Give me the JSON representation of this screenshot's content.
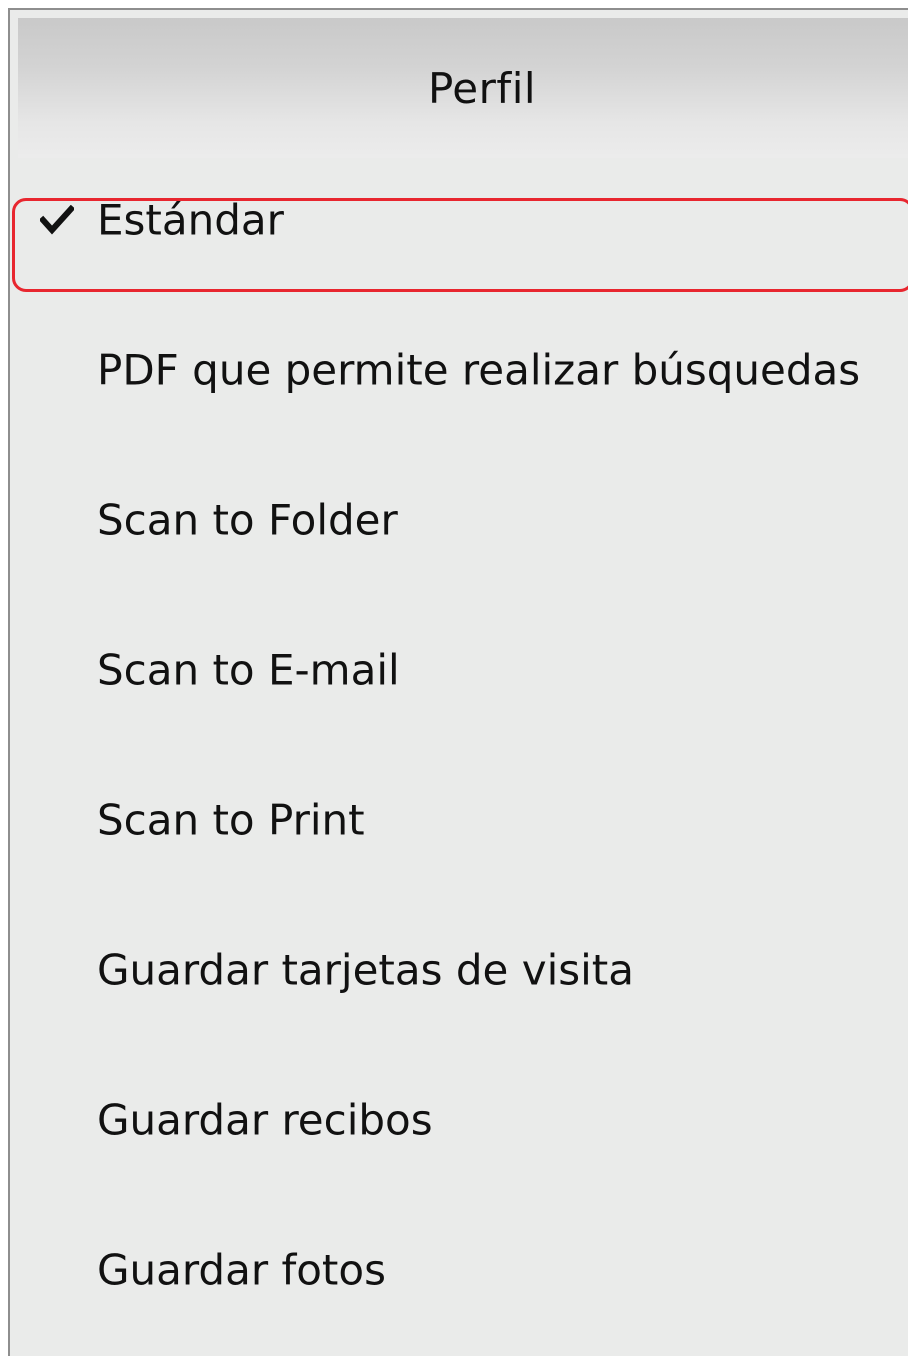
{
  "header": {
    "title": "Perfil"
  },
  "menu": {
    "selected_index": 0,
    "items": [
      {
        "label": "Estándar",
        "checked": true
      },
      {
        "label": "PDF que permite realizar búsquedas",
        "checked": false
      },
      {
        "label": "Scan to Folder",
        "checked": false
      },
      {
        "label": "Scan to E-mail",
        "checked": false
      },
      {
        "label": "Scan to Print",
        "checked": false
      },
      {
        "label": "Guardar tarjetas de visita",
        "checked": false
      },
      {
        "label": "Guardar recibos",
        "checked": false
      },
      {
        "label": "Guardar fotos",
        "checked": false
      }
    ]
  },
  "icons": {
    "checked_item": "checkmark-icon"
  },
  "colors": {
    "highlight_outline": "#e8262f",
    "menu_background": "#eaebea",
    "text": "#111111"
  }
}
